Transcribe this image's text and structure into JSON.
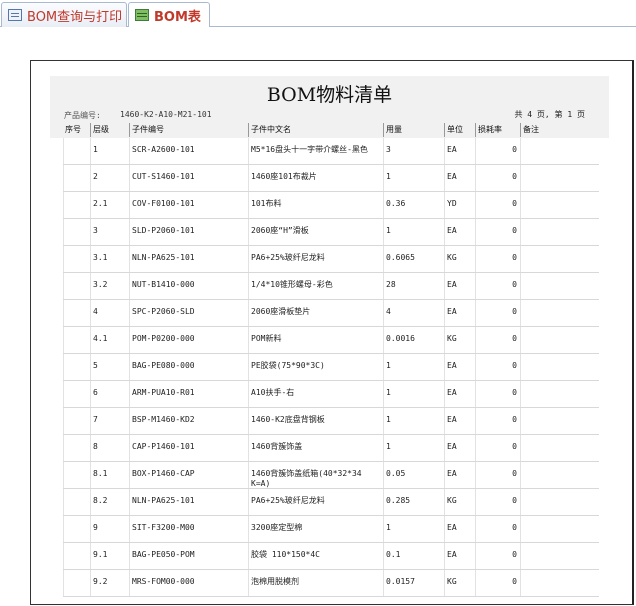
{
  "tabs": [
    {
      "label": "BOM查询与打印",
      "icon": "form-icon",
      "active": false
    },
    {
      "label": "BOM表",
      "icon": "table-icon",
      "active": true
    }
  ],
  "report": {
    "title": "BOM物料清单",
    "product_label": "产品编号:",
    "product_value": "1460-K2-A10-M21-101",
    "page_info": "共 4 页, 第 1 页",
    "columns": [
      "序号",
      "层级",
      "子件编号",
      "子件中文名",
      "用量",
      "单位",
      "损耗率",
      "备注"
    ],
    "rows": [
      {
        "seq": "",
        "level": "1",
        "code": "SCR-A2600-101",
        "name": "M5*16盘头十一字带介螺丝-黑色",
        "qty": "3",
        "unit": "EA",
        "loss": "0",
        "note": ""
      },
      {
        "seq": "",
        "level": "2",
        "code": "CUT-S1460-101",
        "name": "1460座101布裁片",
        "qty": "1",
        "unit": "EA",
        "loss": "0",
        "note": ""
      },
      {
        "seq": "",
        "level": "2.1",
        "code": "COV-F0100-101",
        "name": "101布料",
        "qty": "0.36",
        "unit": "YD",
        "loss": "0",
        "note": ""
      },
      {
        "seq": "",
        "level": "3",
        "code": "SLD-P2060-101",
        "name": "2060座“H”滑板",
        "qty": "1",
        "unit": "EA",
        "loss": "0",
        "note": ""
      },
      {
        "seq": "",
        "level": "3.1",
        "code": "NLN-PA625-101",
        "name": "PA6+25%玻纤尼龙料",
        "qty": "0.6065",
        "unit": "KG",
        "loss": "0",
        "note": ""
      },
      {
        "seq": "",
        "level": "3.2",
        "code": "NUT-B1410-000",
        "name": "1/4*10锥形螺母-彩色",
        "qty": "28",
        "unit": "EA",
        "loss": "0",
        "note": ""
      },
      {
        "seq": "",
        "level": "4",
        "code": "SPC-P2060-SLD",
        "name": "2060座滑板垫片",
        "qty": "4",
        "unit": "EA",
        "loss": "0",
        "note": ""
      },
      {
        "seq": "",
        "level": "4.1",
        "code": "POM-P0200-000",
        "name": "POM新料",
        "qty": "0.0016",
        "unit": "KG",
        "loss": "0",
        "note": ""
      },
      {
        "seq": "",
        "level": "5",
        "code": "BAG-PE080-000",
        "name": "PE胶袋(75*90*3C)",
        "qty": "1",
        "unit": "EA",
        "loss": "0",
        "note": ""
      },
      {
        "seq": "",
        "level": "6",
        "code": "ARM-PUA10-R01",
        "name": "A10扶手-右",
        "qty": "1",
        "unit": "EA",
        "loss": "0",
        "note": ""
      },
      {
        "seq": "",
        "level": "7",
        "code": "BSP-M1460-KD2",
        "name": "1460-K2底盘背钢板",
        "qty": "1",
        "unit": "EA",
        "loss": "0",
        "note": ""
      },
      {
        "seq": "",
        "level": "8",
        "code": "CAP-P1460-101",
        "name": "1460背簇饰盖",
        "qty": "1",
        "unit": "EA",
        "loss": "0",
        "note": ""
      },
      {
        "seq": "",
        "level": "8.1",
        "code": "BOX-P1460-CAP",
        "name": "1460背簇饰盖纸箱(40*32*34 K=A)",
        "qty": "0.05",
        "unit": "EA",
        "loss": "0",
        "note": ""
      },
      {
        "seq": "",
        "level": "8.2",
        "code": "NLN-PA625-101",
        "name": "PA6+25%玻纤尼龙料",
        "qty": "0.285",
        "unit": "KG",
        "loss": "0",
        "note": ""
      },
      {
        "seq": "",
        "level": "9",
        "code": "SIT-F3200-M00",
        "name": "3200座定型棉",
        "qty": "1",
        "unit": "EA",
        "loss": "0",
        "note": ""
      },
      {
        "seq": "",
        "level": "9.1",
        "code": "BAG-PE050-POM",
        "name": "胶袋 110*150*4C",
        "qty": "0.1",
        "unit": "EA",
        "loss": "0",
        "note": ""
      },
      {
        "seq": "",
        "level": "9.2",
        "code": "MRS-FOM00-000",
        "name": "泡棉用脱模剂",
        "qty": "0.0157",
        "unit": "KG",
        "loss": "0",
        "note": ""
      }
    ]
  },
  "colors": {
    "tab_text": "#c0392b",
    "header_band": "#f1f1f1"
  }
}
